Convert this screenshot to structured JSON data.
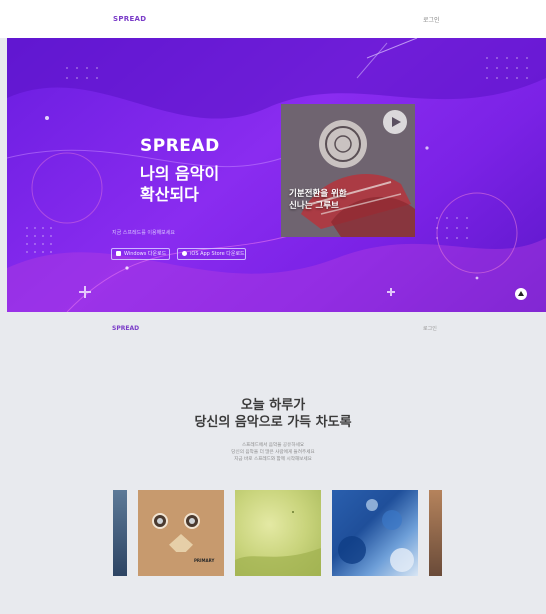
{
  "header": {
    "logo": "SPREAD",
    "login": "로그인"
  },
  "hero": {
    "brand": "SPREAD",
    "title_lines": [
      "나의 음악이",
      "확산되다"
    ],
    "subtitle": "지금 스프레드를 이용해보세요",
    "stores": [
      {
        "label": "Windows 다운로드",
        "icon": "windows-icon"
      },
      {
        "label": "iOS App Store 다운로드",
        "icon": "apple-icon"
      }
    ],
    "card": {
      "caption_lines": [
        "기분전환을 위한",
        "신나는 그루브"
      ],
      "icon": "play-icon"
    }
  },
  "subheader": {
    "logo": "SPREAD",
    "login": "로그인"
  },
  "section": {
    "heading_lines": [
      "오늘 하루가",
      "당신의 음악으로 가득 차도록"
    ],
    "copy_lines": [
      "스프레드에서 음악을 공유하세요",
      "당신의 음악을 더 많은 사람에게 들려주세요",
      "지금 바로 스프레드와 함께 시작해보세요"
    ],
    "albums": [
      {
        "label": ""
      },
      {
        "label": "PRIMARY"
      },
      {
        "label": ""
      },
      {
        "label": ""
      },
      {
        "label": ""
      }
    ]
  },
  "colors": {
    "brand": "#7a3cc8",
    "hero_start": "#6a1de0",
    "hero_end": "#5b17c8",
    "page_bg": "#e8eaee"
  }
}
